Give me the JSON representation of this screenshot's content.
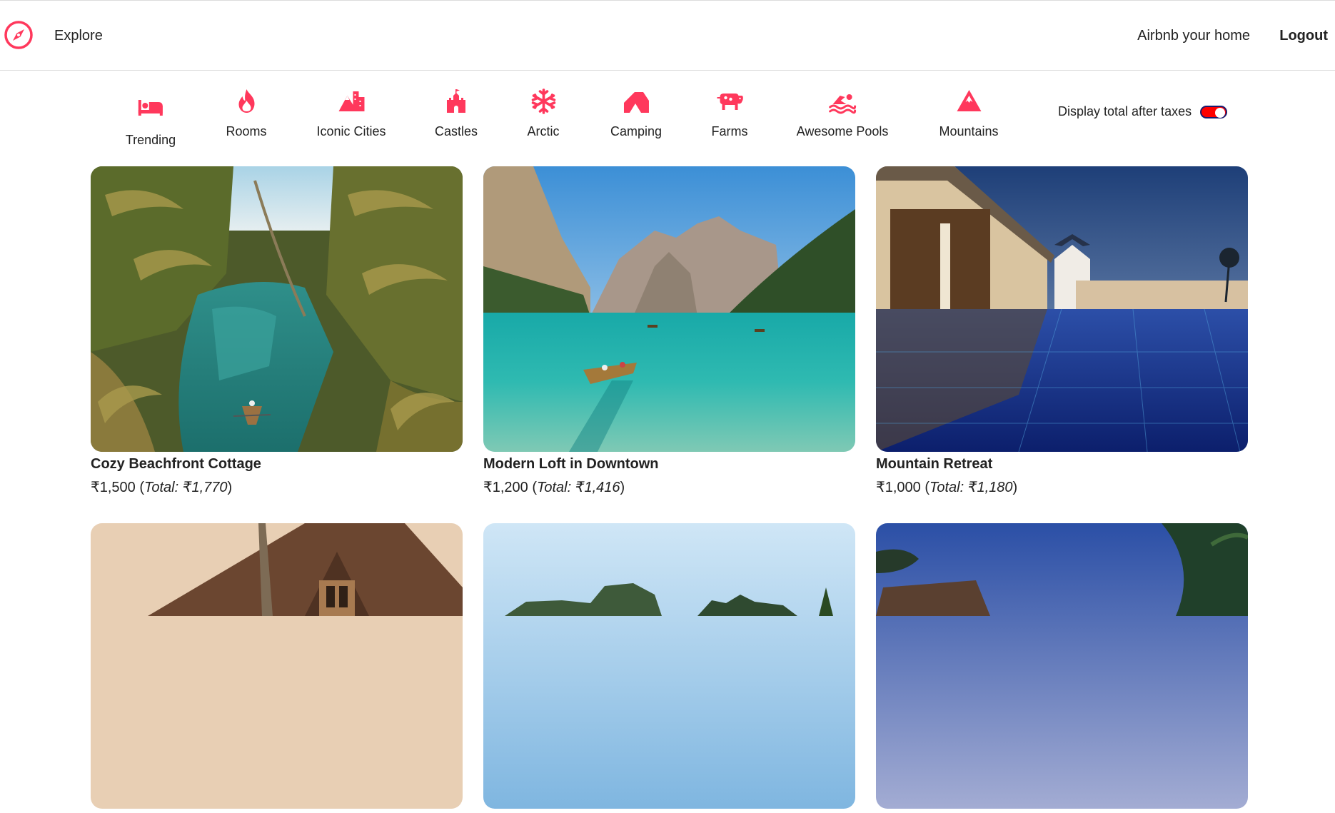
{
  "nav": {
    "logo_icon": "compass-icon",
    "explore_label": "Explore",
    "host_label": "Airbnb your home",
    "logout_label": "Logout"
  },
  "filters": [
    {
      "label": "Trending",
      "icon": "bed-icon"
    },
    {
      "label": "Rooms",
      "icon": "fire-icon"
    },
    {
      "label": "Iconic Cities",
      "icon": "mountain-city-icon"
    },
    {
      "label": "Castles",
      "icon": "castle-icon"
    },
    {
      "label": "Arctic",
      "icon": "snowflake-icon"
    },
    {
      "label": "Camping",
      "icon": "tent-icon"
    },
    {
      "label": "Farms",
      "icon": "cow-icon"
    },
    {
      "label": "Awesome Pools",
      "icon": "swimmer-icon"
    },
    {
      "label": "Mountains",
      "icon": "mountain-icon"
    }
  ],
  "tax_toggle": {
    "label": "Display total after taxes",
    "on": true
  },
  "listings": [
    {
      "title": "Cozy Beachfront Cottage",
      "price": "₹1,500",
      "paren_open": " (",
      "total": "Total: ₹1,770",
      "paren_close": ")"
    },
    {
      "title": "Modern Loft in Downtown",
      "price": "₹1,200",
      "paren_open": " (",
      "total": "Total: ₹1,416",
      "paren_close": ")"
    },
    {
      "title": "Mountain Retreat",
      "price": "₹1,000",
      "paren_open": " (",
      "total": "Total: ₹1,180",
      "paren_close": ")"
    },
    {
      "title": "",
      "price": "",
      "paren_open": "",
      "total": "",
      "paren_close": ""
    },
    {
      "title": "",
      "price": "",
      "paren_open": "",
      "total": "",
      "paren_close": ""
    },
    {
      "title": "",
      "price": "",
      "paren_open": "",
      "total": "",
      "paren_close": ""
    }
  ],
  "colors": {
    "accent": "#ff385c",
    "toggle_on": "#ff0000",
    "text": "#222222"
  }
}
